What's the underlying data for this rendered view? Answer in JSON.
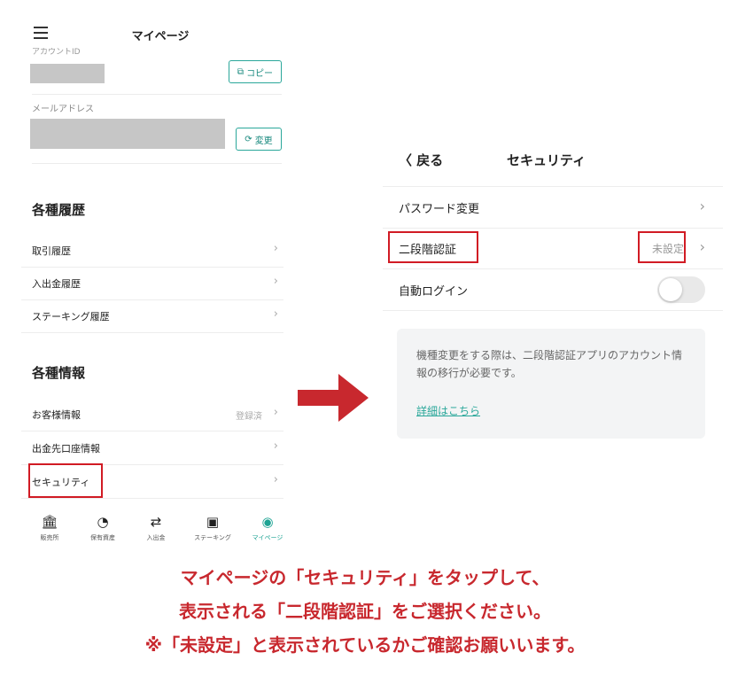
{
  "left_screen": {
    "title": "マイページ",
    "cut_label": "アカウントID",
    "copy_button": "コピー",
    "email_label": "メールアドレス",
    "change_button": "変更",
    "history": {
      "heading": "各種履歴",
      "items": [
        {
          "label": "取引履歴"
        },
        {
          "label": "入出金履歴"
        },
        {
          "label": "ステーキング履歴"
        }
      ]
    },
    "info": {
      "heading": "各種情報",
      "items": [
        {
          "label": "お客様情報",
          "value": "登録済"
        },
        {
          "label": "出金先口座情報",
          "value": ""
        },
        {
          "label": "セキュリティ",
          "value": ""
        }
      ]
    },
    "tabs": [
      {
        "label": "販売所",
        "icon": "bank-icon"
      },
      {
        "label": "保有資産",
        "icon": "pie-chart-icon"
      },
      {
        "label": "入出金",
        "icon": "transfer-icon"
      },
      {
        "label": "ステーキング",
        "icon": "staking-icon"
      },
      {
        "label": "マイページ",
        "icon": "user-icon",
        "active": true
      }
    ]
  },
  "right_screen": {
    "back_label": "戻る",
    "title": "セキュリティ",
    "rows": [
      {
        "label": "パスワード変更",
        "value": ""
      },
      {
        "label": "二段階認証",
        "value": "未設定"
      },
      {
        "label": "自動ログイン",
        "toggle": false
      }
    ],
    "notice": "機種変更をする際は、二段階認証アプリのアカウント情報の移行が必要です。",
    "link": "詳細はこちら"
  },
  "caption": {
    "line1": "マイページの「セキュリティ」をタップして、",
    "line2": "表示される「二段階認証」をご選択ください。",
    "line3": "※「未設定」と表示されているかご確認お願いいます。"
  },
  "colors": {
    "accent": "#2aa79a",
    "highlight": "#d11b24",
    "arrow": "#c8282e",
    "caption": "#c8282e"
  }
}
